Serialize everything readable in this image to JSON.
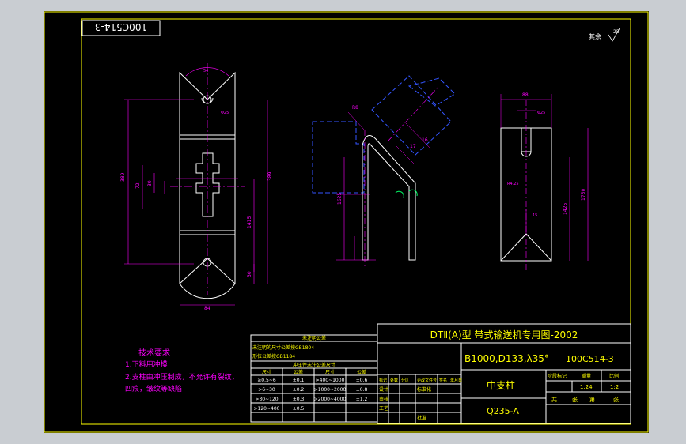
{
  "drawing": {
    "code": "100C514-3",
    "roughness_label": "其余",
    "roughness_value": "25"
  },
  "tech_requirements": {
    "title": "技术要求",
    "lines": [
      "1.下料用冲模",
      "2.支柱由冲压制成，不允许有裂纹，",
      "四痕，皱纹等缺陷"
    ]
  },
  "tolerance_table": {
    "header": "未注明公差",
    "lines": [
      "未注明的尺寸公差按GB1804",
      "形位公差按GB1184"
    ],
    "subheader": "冲压件未注公差尺寸",
    "col_headers": [
      "尺寸",
      "公差",
      "尺寸",
      "公差"
    ],
    "rows": [
      [
        "≥0.5~6",
        "±0.1",
        ">400~1000",
        "±0.6"
      ],
      [
        ">6~30",
        "±0.2",
        ">1000~2000",
        "±0.8"
      ],
      [
        ">30~120",
        "±0.3",
        ">2000~4000",
        "±1.2"
      ],
      [
        ">120~400",
        "±0.5",
        "",
        ""
      ]
    ]
  },
  "title_block": {
    "series": "DTⅡ(A)型  带式输送机专用图-2002",
    "spec": "B1000,D133,λ35°",
    "code": "100C514-3",
    "part_name": "中支柱",
    "material": "Q235-A",
    "sign_labels": [
      "标记",
      "处数",
      "分区",
      "更改文件号",
      "签名",
      "年月日"
    ],
    "role_labels": [
      "设计",
      "审核",
      "工艺",
      "标准化",
      "批准"
    ],
    "stage_label": "阶段标记",
    "weight_label": "重量",
    "scale_label": "比例",
    "weight": "1.24",
    "scale": "1:2",
    "sheet_labels": [
      "共",
      "张",
      "第",
      "张"
    ]
  },
  "dims": {
    "front_width_top": "54",
    "front_hole_d": "Φ25",
    "front_height_total": "389",
    "front_height_mid": "72",
    "front_slot": "30",
    "front_height_right": "1415",
    "front_bottom": "30",
    "front_width_bottom": "84",
    "side_r": "R8",
    "side_h": "1625",
    "side_17": "17",
    "side_16": "16",
    "right_width": "88",
    "right_d": "Φ25",
    "right_r": "R4.25",
    "right_h": "1425",
    "right_h2": "1750",
    "right_h3": "15"
  },
  "colors": {
    "yellow": "#ffff00",
    "white": "#ffffff",
    "magenta": "#ff00ff",
    "blue": "#3355ff",
    "green": "#00ff66"
  }
}
